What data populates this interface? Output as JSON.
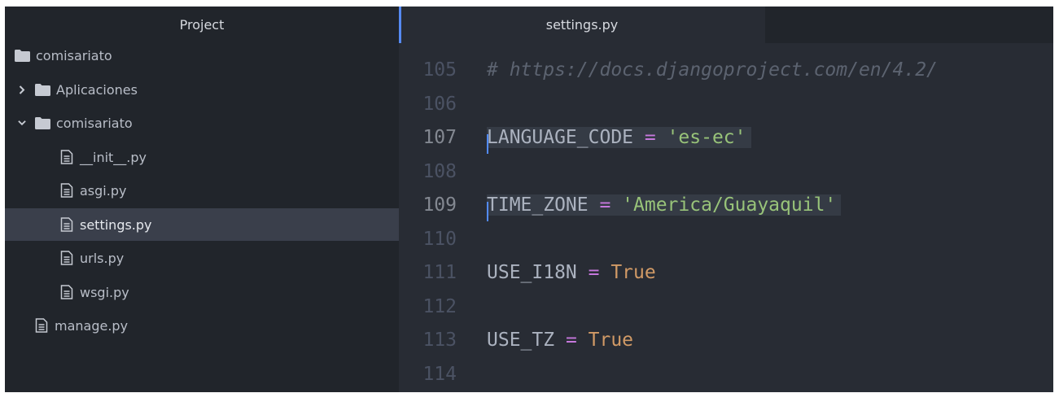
{
  "sidebar": {
    "title": "Project",
    "items": [
      {
        "label": "comisariato",
        "kind": "folder",
        "level": 0,
        "chevron": "",
        "selected": false
      },
      {
        "label": "Aplicaciones",
        "kind": "folder",
        "level": 1,
        "chevron": "collapsed",
        "selected": false
      },
      {
        "label": "comisariato",
        "kind": "folder",
        "level": 1,
        "chevron": "expanded",
        "selected": false
      },
      {
        "label": "__init__.py",
        "kind": "file",
        "level": 2,
        "chevron": "",
        "selected": false
      },
      {
        "label": "asgi.py",
        "kind": "file",
        "level": 2,
        "chevron": "",
        "selected": false
      },
      {
        "label": "settings.py",
        "kind": "file",
        "level": 2,
        "chevron": "",
        "selected": true
      },
      {
        "label": "urls.py",
        "kind": "file",
        "level": 2,
        "chevron": "",
        "selected": false
      },
      {
        "label": "wsgi.py",
        "kind": "file",
        "level": 2,
        "chevron": "",
        "selected": false
      },
      {
        "label": "manage.py",
        "kind": "file",
        "level": 1,
        "chevron": "",
        "selected": false
      }
    ]
  },
  "editor": {
    "active_tab": "settings.py",
    "lines": [
      {
        "num": "105",
        "active": false,
        "highlight": false,
        "tokens": [
          {
            "t": "comment",
            "v": "# https://docs.djangoproject.com/en/4.2/"
          }
        ]
      },
      {
        "num": "106",
        "active": false,
        "highlight": false,
        "tokens": []
      },
      {
        "num": "107",
        "active": true,
        "highlight": true,
        "tokens": [
          {
            "t": "name",
            "v": "LANGUAGE_CODE"
          },
          {
            "t": "op",
            "v": " = "
          },
          {
            "t": "str",
            "v": "'es-ec'"
          }
        ]
      },
      {
        "num": "108",
        "active": false,
        "highlight": false,
        "tokens": []
      },
      {
        "num": "109",
        "active": true,
        "highlight": true,
        "tokens": [
          {
            "t": "name",
            "v": "TIME_ZONE"
          },
          {
            "t": "op",
            "v": " = "
          },
          {
            "t": "str",
            "v": "'America/Guayaquil'"
          }
        ]
      },
      {
        "num": "110",
        "active": false,
        "highlight": false,
        "tokens": []
      },
      {
        "num": "111",
        "active": false,
        "highlight": false,
        "tokens": [
          {
            "t": "name",
            "v": "USE_I18N"
          },
          {
            "t": "op",
            "v": " = "
          },
          {
            "t": "const",
            "v": "True"
          }
        ]
      },
      {
        "num": "112",
        "active": false,
        "highlight": false,
        "tokens": []
      },
      {
        "num": "113",
        "active": false,
        "highlight": false,
        "tokens": [
          {
            "t": "name",
            "v": "USE_TZ"
          },
          {
            "t": "op",
            "v": " = "
          },
          {
            "t": "const",
            "v": "True"
          }
        ]
      },
      {
        "num": "114",
        "active": false,
        "highlight": false,
        "tokens": []
      }
    ]
  },
  "colors": {
    "sidebar_bg": "#21252b",
    "editor_bg": "#282c34",
    "selection_bg": "#3a3f4b",
    "cursor": "#528bff",
    "string": "#98c379",
    "keyword_op": "#c678dd",
    "constant": "#d19a66",
    "comment": "#5c6370"
  }
}
